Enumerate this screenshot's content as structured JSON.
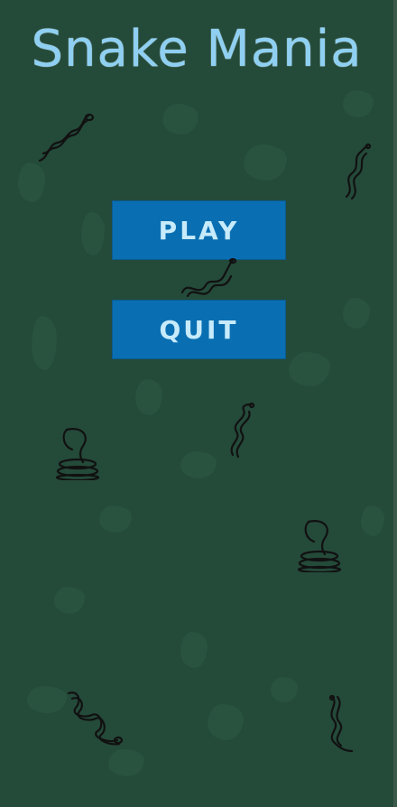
{
  "title": "Snake Mania",
  "menu": {
    "play_label": "PLAY",
    "quit_label": "QUIT"
  },
  "colors": {
    "background": "#244a3a",
    "title": "#8fd0f2",
    "button": "#0a6fb2",
    "button_text": "#c7ebfb"
  },
  "icons": [
    "snake-icon",
    "snake-icon",
    "snake-icon",
    "snake-icon",
    "cobra-icon",
    "cobra-icon",
    "snake-icon",
    "snake-icon"
  ]
}
